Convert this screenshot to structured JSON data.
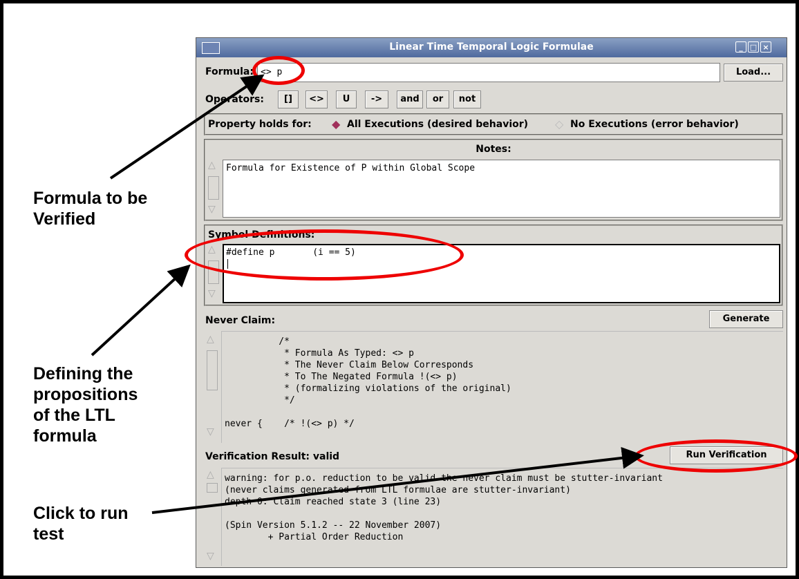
{
  "window": {
    "title": "Linear Time Temporal Logic Formulae"
  },
  "formula": {
    "label": "Formula:",
    "value": "<> p",
    "load_label": "Load..."
  },
  "operators": {
    "label": "Operators:",
    "items": [
      "[]",
      "<>",
      "U",
      "->",
      "and",
      "or",
      "not"
    ]
  },
  "property": {
    "label": "Property holds for:",
    "option_all": "All Executions (desired behavior)",
    "option_none": "No Executions (error behavior)",
    "selected": "all"
  },
  "notes": {
    "label": "Notes:",
    "text": "Formula for Existence of P within Global Scope"
  },
  "symbols": {
    "label": "Symbol Definitions:",
    "text": "#define p       (i == 5)"
  },
  "never_claim": {
    "label": "Never Claim:",
    "generate_label": "Generate",
    "text": "          /*\n           * Formula As Typed: <> p\n           * The Never Claim Below Corresponds\n           * To The Negated Formula !(<> p)\n           * (formalizing violations of the original)\n           */\n\nnever {    /* !(<> p) */"
  },
  "verification": {
    "label": "Verification Result: valid",
    "run_label": "Run Verification",
    "text": "warning: for p.o. reduction to be valid the never claim must be stutter-invariant\n(never claims generated from LTL formulae are stutter-invariant)\ndepth 0: Claim reached state 3 (line 23)\n\n(Spin Version 5.1.2 -- 22 November 2007)\n        + Partial Order Reduction"
  },
  "callouts": {
    "formula": "Formula to be\nVerified",
    "propositions": "Defining the\npropositions\nof the LTL\nformula",
    "run": "Click to run\ntest"
  }
}
